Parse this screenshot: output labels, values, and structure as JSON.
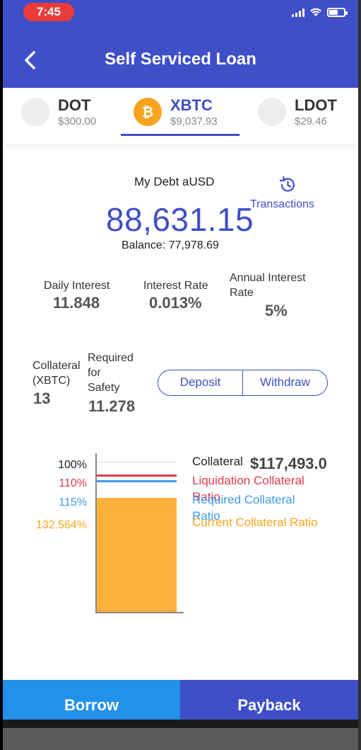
{
  "status_bar": {
    "time": "7:45"
  },
  "header": {
    "title": "Self Serviced Loan"
  },
  "tokens": [
    {
      "name": "DOT",
      "price": "$300.00"
    },
    {
      "name": "XBTC",
      "price": "$9,037.93",
      "active": true
    },
    {
      "name": "LDOT",
      "price": "$29.46"
    }
  ],
  "debt": {
    "label": "My Debt aUSD",
    "value": "88,631.15",
    "balance": "Balance: 77,978.69",
    "transactions_label": "Transactions"
  },
  "interest": {
    "daily_label": "Daily Interest",
    "daily_value": "11.848",
    "rate_label": "Interest Rate",
    "rate_value": "0.013%",
    "annual_label_1": "Annual Interest",
    "annual_label_2": "Rate",
    "annual_value": "5%"
  },
  "collateral": {
    "label_1": "Collateral",
    "label_2": "(XBTC)",
    "value": "13",
    "required_1": "Required",
    "required_2": "for",
    "required_3": "Safety",
    "required_value": "11.278",
    "deposit_label": "Deposit",
    "withdraw_label": "Withdraw"
  },
  "chart": {
    "ratio_100": "100%",
    "ratio_110": "110%",
    "ratio_115": "115%",
    "ratio_current": "132.564%",
    "collateral_title": "Collateral",
    "collateral_value": "$117,493.0",
    "legend_liquidation_1": "Liquidation Collateral",
    "legend_liquidation_2": "Ratio",
    "legend_required_1": "Required Collateral",
    "legend_required_2": "Ratio",
    "legend_current": "Current Collateral Ratio",
    "colors": {
      "liquidation": "#e2384d",
      "required": "#3e9be8",
      "current": "#fbb03b"
    }
  },
  "actions": {
    "borrow_label": "Borrow",
    "payback_label": "Payback"
  },
  "colors": {
    "primary": "#3f4fc7",
    "borrow": "#2390ea",
    "time_pill": "#ea3b3b"
  }
}
